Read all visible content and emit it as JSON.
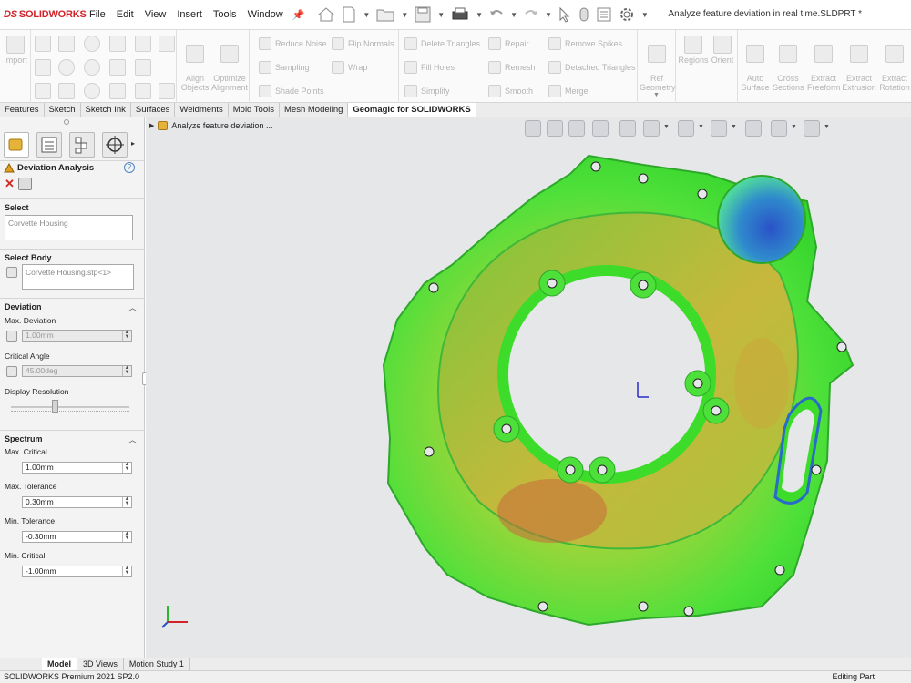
{
  "app": {
    "brand": "SOLIDWORKS",
    "brand_prefix": "DS",
    "doc_title": "Analyze feature deviation in real time.SLDPRT *"
  },
  "menu": [
    "File",
    "Edit",
    "View",
    "Insert",
    "Tools",
    "Window"
  ],
  "command_manager": {
    "import": "Import",
    "align_objects": "Align\nObjects",
    "optimize_alignment": "Optimize\nAlignment",
    "reduce_noise": "Reduce Noise",
    "flip_normals": "Flip Normals",
    "sampling": "Sampling",
    "wrap": "Wrap",
    "shade_points": "Shade Points",
    "delete_triangles": "Delete Triangles",
    "repair": "Repair",
    "remove_spikes": "Remove Spikes",
    "fill_holes": "Fill Holes",
    "remesh": "Remesh",
    "detached_triangles": "Detached Triangles",
    "simplify": "Simplify",
    "smooth": "Smooth",
    "merge": "Merge",
    "ref_geometry": "Ref\nGeometry",
    "regions": "Regions",
    "orient": "Orient",
    "auto_surface": "Auto\nSurface",
    "cross_sections": "Cross\nSections",
    "extract_freeform": "Extract\nFreeform",
    "extract_extrusion": "Extract\nExtrusion",
    "extract_rotation": "Extract\nRotation"
  },
  "tabs": [
    "Features",
    "Sketch",
    "Sketch Ink",
    "Surfaces",
    "Weldments",
    "Mold Tools",
    "Mesh Modeling",
    "Geomagic for SOLIDWORKS"
  ],
  "active_tab": "Geomagic for SOLIDWORKS",
  "tree": {
    "feature": "Analyze feature deviation ..."
  },
  "property_manager": {
    "title": "Deviation Analysis",
    "help": "?",
    "select": {
      "title": "Select",
      "value": "Corvette Housing"
    },
    "select_body": {
      "title": "Select Body",
      "value": "Corvette Housing.stp<1>"
    },
    "deviation": {
      "title": "Deviation",
      "max_deviation_label": "Max. Deviation",
      "max_deviation": "1.00mm",
      "critical_angle_label": "Critical Angle",
      "critical_angle": "45.00deg",
      "display_resolution_label": "Display Resolution",
      "display_resolution_level": 0.37
    },
    "spectrum": {
      "title": "Spectrum",
      "max_critical_label": "Max. Critical",
      "max_critical": "1.00mm",
      "max_tolerance_label": "Max. Tolerance",
      "max_tolerance": "0.30mm",
      "min_tolerance_label": "Min. Tolerance",
      "min_tolerance": "-0.30mm",
      "min_critical_label": "Min. Critical",
      "min_critical": "-1.00mm"
    }
  },
  "bottom_tabs": [
    "Model",
    "3D Views",
    "Motion Study 1"
  ],
  "status": {
    "left": "SOLIDWORKS Premium 2021 SP2.0",
    "right": "Editing Part"
  },
  "colors": {
    "accent_red": "#d2232a",
    "deviation_green": "#3ddc2a",
    "deviation_yellow": "#c9c23a",
    "deviation_red": "#c24a2a",
    "deviation_blue": "#2a52c8"
  }
}
